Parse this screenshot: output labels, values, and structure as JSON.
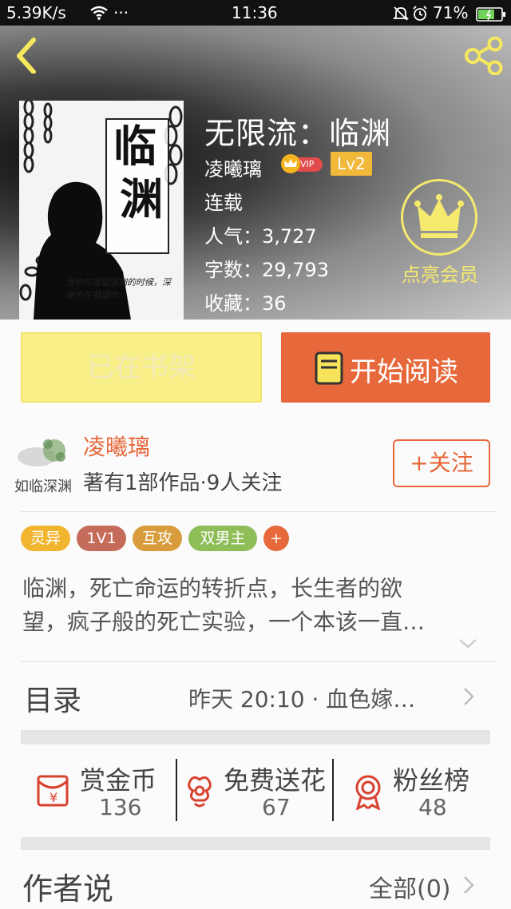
{
  "status_bar": {
    "net_speed": "5.39K/s",
    "more": "···",
    "time": "11:36",
    "battery_pct": "71%",
    "battery_level": 0.71
  },
  "book": {
    "title": "无限流：临渊",
    "author": "凌曦璃",
    "vip_badge": "VIP",
    "level": "Lv2",
    "status": "连载",
    "popularity": "人气：3,727",
    "word_count": "字数：29,793",
    "favorites": "收藏：36",
    "cover": {
      "title_char_1": "临",
      "title_char_2": "渊",
      "caption": "当你在凝望深渊的时候，深渊也在凝望你。"
    }
  },
  "vip_cta": {
    "label": "点亮会员"
  },
  "buttons": {
    "on_shelf": "已在书架",
    "start_reading": "开始阅读"
  },
  "author_block": {
    "avatar_text": "如临深渊",
    "name": "凌曦璃",
    "works": "著有1部作品·9人关注",
    "follow": "+关注"
  },
  "tags": [
    {
      "label": "灵异",
      "color": "#f2b530"
    },
    {
      "label": "1V1",
      "color": "#c46b5a"
    },
    {
      "label": "互攻",
      "color": "#d89c3c"
    },
    {
      "label": "双男主",
      "color": "#8fbd58"
    },
    {
      "label": "+",
      "color": "#e7683a"
    }
  ],
  "synopsis": {
    "line1": "临渊，死亡命运的转折点，长生者的欲",
    "line2": "望，疯子般的死亡实验，一个本该一直…"
  },
  "toc": {
    "label": "目录",
    "latest": "昨天 20:10 · 血色嫁…"
  },
  "stats": {
    "reward": {
      "label": "赏金币",
      "value": "136"
    },
    "flowers": {
      "label": "免费送花",
      "value": "67"
    },
    "fans": {
      "label": "粉丝榜",
      "value": "48"
    }
  },
  "author_says": {
    "label": "作者说",
    "all": "全部(0)"
  },
  "colors": {
    "accent": "#e7683a",
    "shelf_button": "#f9f08a",
    "vip_yellow": "#f6ea6e"
  }
}
